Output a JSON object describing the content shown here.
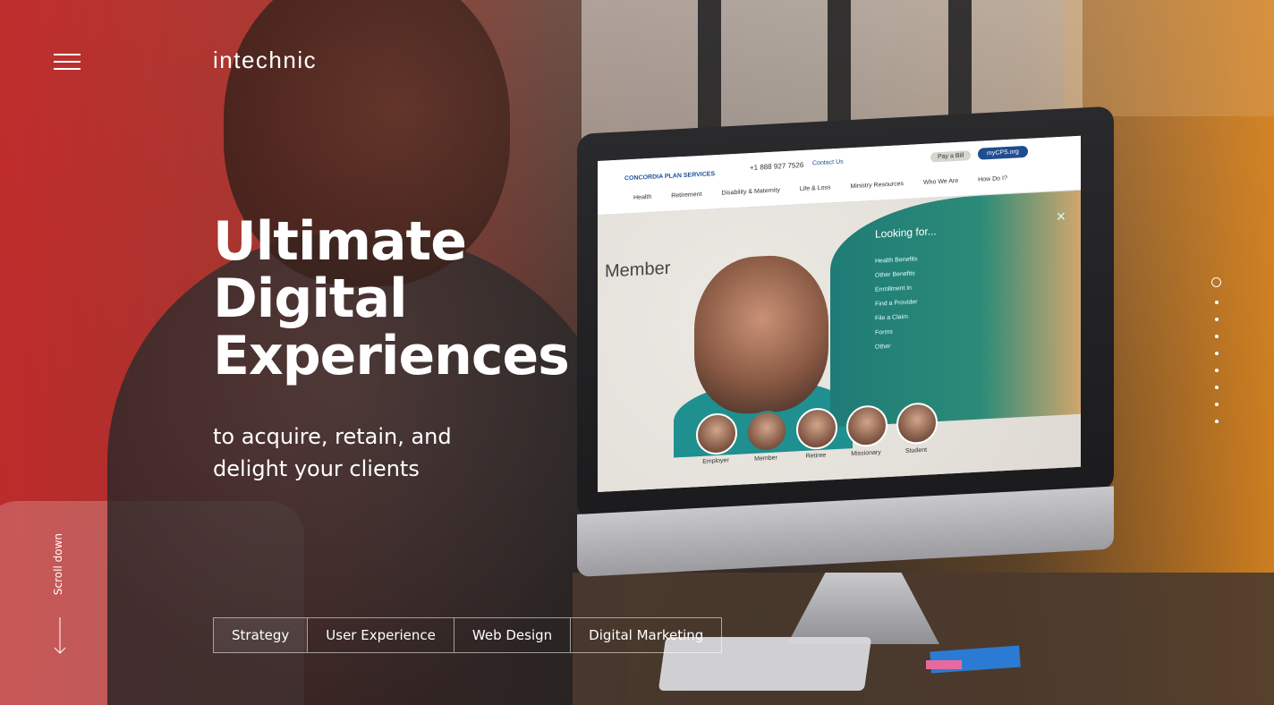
{
  "brand": {
    "logo_text": "intechnic"
  },
  "hero": {
    "headline": [
      "Ultimate",
      "Digital",
      "Experiences"
    ],
    "subline": [
      "to acquire, retain, and",
      "delight your clients"
    ]
  },
  "services_tabs": [
    {
      "label": "Strategy"
    },
    {
      "label": "User Experience"
    },
    {
      "label": "Web Design"
    },
    {
      "label": "Digital Marketing"
    }
  ],
  "scroll": {
    "label": "Scroll down"
  },
  "slides": {
    "count": 9,
    "active": 0
  },
  "icons": {
    "menu": "hamburger-menu-icon",
    "scroll": "arrow-down-icon"
  },
  "colors": {
    "red": "#c42b2b",
    "orange": "#e88c1e",
    "white": "#ffffff"
  },
  "screen_mock": {
    "logo": "CONCORDIA PLAN SERVICES",
    "phone": "+1 888 927 7526",
    "contact": "Contact Us",
    "pay": "Pay a Bill",
    "myops": "myCPS.org",
    "nav": [
      "Health",
      "Retirement",
      "Disability & Maternity",
      "Life & Loss",
      "Ministry Resources",
      "Who We Are",
      "How Do I?"
    ],
    "member_label": "Member",
    "panel_title": "Looking for...",
    "panel_items": [
      "Health Benefits",
      "Other Benefits",
      "Enrollment in",
      "Find a Provider",
      "File a Claim",
      "Forms",
      "Other"
    ],
    "audiences": [
      "Employer",
      "Member",
      "Retiree",
      "Missionary",
      "Student"
    ]
  }
}
